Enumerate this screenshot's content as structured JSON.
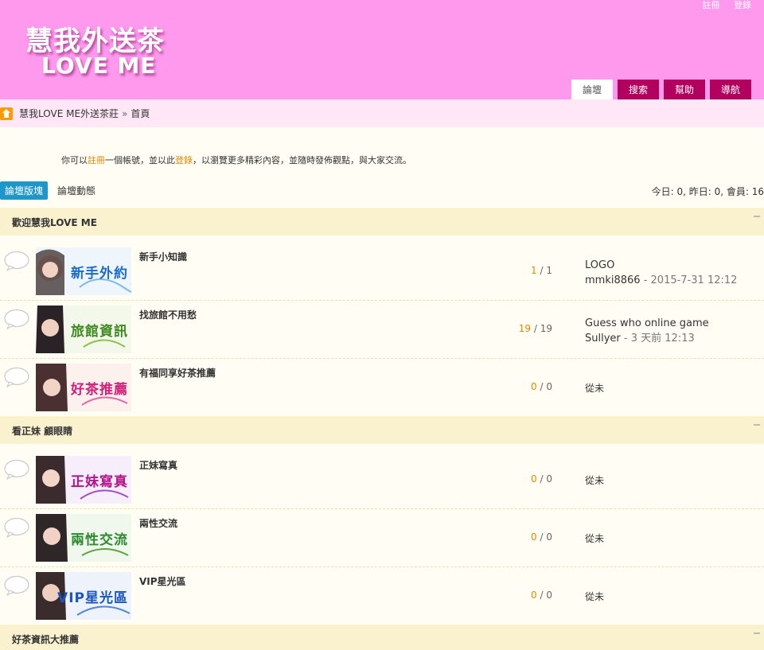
{
  "header": {
    "register_link": "註冊",
    "login_link": "登錄",
    "logo_cn": "慧我外送茶",
    "logo_en": "LOVE ME",
    "nav": [
      {
        "label": "論壇",
        "active": true
      },
      {
        "label": "搜索",
        "active": false
      },
      {
        "label": "幫助",
        "active": false
      },
      {
        "label": "導航",
        "active": false
      }
    ]
  },
  "breadcrumb": {
    "site": "慧我LOVE ME外送茶莊",
    "sep": "»",
    "current": "首頁"
  },
  "notice": {
    "pre": "你可以",
    "register": "註冊",
    "mid": "一個帳號，並以此",
    "login": "登錄",
    "post": "，以瀏覽更多精彩內容，並隨時發佈觀點，與大家交流。"
  },
  "tabs": {
    "forums": "論壇版塊",
    "activity": "論壇動態"
  },
  "stats": "今日: 0, 昨日: 0, 會員: 16",
  "sections": [
    {
      "title": "歡迎慧我LOVE ME",
      "forums": [
        {
          "name": "新手小知識",
          "thumb_text": "新手外約",
          "thumb_color": "#1a6bd0",
          "threads": "1",
          "posts": "1",
          "last_title": "LOGO",
          "last_user": "mmki8866",
          "last_time": "2015-7-31 12:12"
        },
        {
          "name": "找旅館不用愁",
          "thumb_text": "旅館資訊",
          "thumb_color": "#3a8a1e",
          "threads": "19",
          "posts": "19",
          "last_title": "Guess who online game",
          "last_user": "Sullyer",
          "last_time": "3 天前 12:13"
        },
        {
          "name": "有福同享好茶推薦",
          "thumb_text": "好茶推薦",
          "thumb_color": "#d0207a",
          "threads": "0",
          "posts": "0",
          "last_never": "從未"
        }
      ]
    },
    {
      "title": "看正妹 顧眼睛",
      "forums": [
        {
          "name": "正妹寫真",
          "thumb_text": "正妹寫真",
          "thumb_color": "#b2148c",
          "threads": "0",
          "posts": "0",
          "last_never": "從未"
        },
        {
          "name": "兩性交流",
          "thumb_text": "兩性交流",
          "thumb_color": "#2e8a2e",
          "threads": "0",
          "posts": "0",
          "last_never": "從未"
        },
        {
          "name": "VIP星光區",
          "thumb_text": "VIP星光區",
          "thumb_color": "#1a55c0",
          "threads": "0",
          "posts": "0",
          "last_never": "從未"
        }
      ]
    },
    {
      "title": "好茶資訊大推薦",
      "forums": []
    }
  ]
}
